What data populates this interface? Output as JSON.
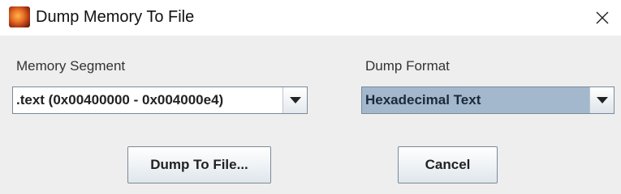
{
  "window": {
    "title": "Dump Memory To File"
  },
  "memory_segment": {
    "label": "Memory Segment",
    "selected": ".text (0x00400000 - 0x004000e4)"
  },
  "dump_format": {
    "label": "Dump Format",
    "selected": "Hexadecimal Text"
  },
  "buttons": {
    "dump": "Dump To File...",
    "cancel": "Cancel"
  },
  "icons": {
    "app": "mars-planet-icon",
    "close": "close-icon",
    "dropdown": "chevron-down-icon"
  },
  "colors": {
    "selected_combo_bg": "#a3b8cc",
    "button_border": "#7a8a99"
  }
}
